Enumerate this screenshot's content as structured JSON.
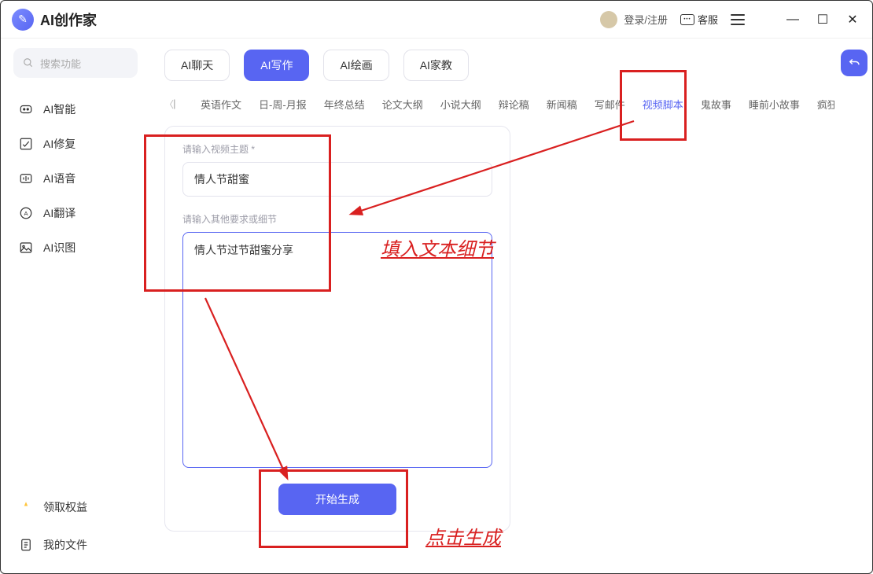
{
  "app": {
    "title": "AI创作家"
  },
  "header": {
    "login_text": "登录/注册",
    "customer_service": "客服"
  },
  "sidebar": {
    "search_placeholder": "搜索功能",
    "items": [
      {
        "label": "AI智能"
      },
      {
        "label": "AI修复"
      },
      {
        "label": "AI语音"
      },
      {
        "label": "AI翻译"
      },
      {
        "label": "AI识图"
      }
    ],
    "bottom": [
      {
        "label": "领取权益"
      },
      {
        "label": "我的文件"
      }
    ]
  },
  "tabs": [
    {
      "label": "AI聊天",
      "active": false
    },
    {
      "label": "AI写作",
      "active": true
    },
    {
      "label": "AI绘画",
      "active": false
    },
    {
      "label": "AI家教",
      "active": false
    }
  ],
  "subtabs": [
    "英语作文",
    "日-周-月报",
    "年终总结",
    "论文大纲",
    "小说大纲",
    "辩论稿",
    "新闻稿",
    "写邮件",
    "视频脚本",
    "鬼故事",
    "睡前小故事",
    "疯狂"
  ],
  "subtab_active_index": 8,
  "form": {
    "topic_label": "请输入视频主题 *",
    "topic_value": "情人节甜蜜",
    "detail_label": "请输入其他要求或细节",
    "detail_value": "情人节过节甜蜜分享",
    "submit": "开始生成"
  },
  "annotations": {
    "fill_text": "填入文本细节",
    "click_generate": "点击生成"
  }
}
